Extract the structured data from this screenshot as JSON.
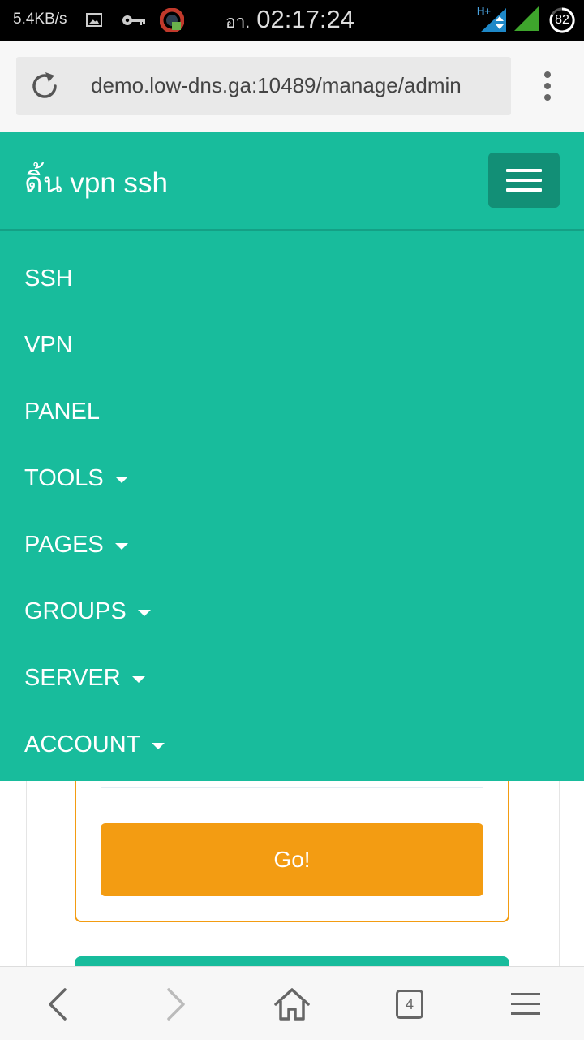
{
  "status_bar": {
    "net_speed": "5.4KB/s",
    "time_prefix": "อา.",
    "time": "02:17:24",
    "network_type": "H+",
    "battery_level": "82",
    "icons": [
      "image-icon",
      "key-icon",
      "app-icon",
      "network-hplus-icon",
      "signal-icon",
      "battery-icon"
    ]
  },
  "browser": {
    "url": "demo.low-dns.ga:10489/manage/admin",
    "open_tabs": "4",
    "icons": [
      "reload-icon",
      "overflow-menu-icon",
      "back-icon",
      "forward-icon",
      "home-icon",
      "tabs-icon",
      "menu-icon"
    ]
  },
  "navbar": {
    "brand": "ดิ้น vpn ssh",
    "toggle_icon": "hamburger-icon",
    "items": [
      {
        "label": "SSH",
        "dropdown": false
      },
      {
        "label": "VPN",
        "dropdown": false
      },
      {
        "label": "PANEL",
        "dropdown": false
      },
      {
        "label": "TOOLS",
        "dropdown": true
      },
      {
        "label": "PAGES",
        "dropdown": true
      },
      {
        "label": "GROUPS",
        "dropdown": true
      },
      {
        "label": "SERVER",
        "dropdown": true
      },
      {
        "label": "ACCOUNT",
        "dropdown": true
      }
    ]
  },
  "form": {
    "submit_label": "Go!"
  },
  "colors": {
    "navbar": "#18bc9c",
    "navbar_toggle": "#128f76",
    "button_warning": "#f39c12",
    "status_bar": "#000000"
  }
}
